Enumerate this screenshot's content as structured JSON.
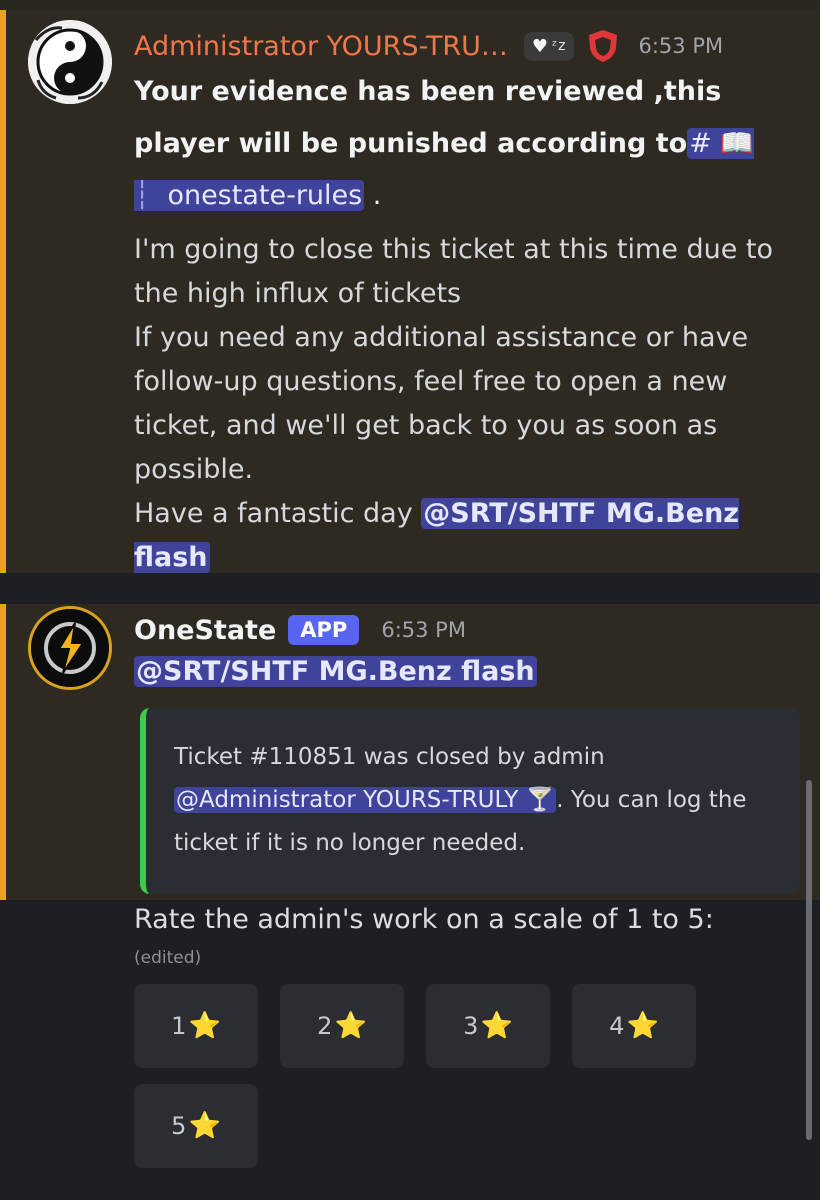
{
  "message1": {
    "author": "Administrator YOURS-TRU…",
    "status_icons": [
      "heart-icon",
      "sleep-zzz-icon"
    ],
    "status_zzz": "ᶻz",
    "badge_icon": "shield-icon",
    "badge_color": "#e0373a",
    "time": "6:53 PM",
    "bold_lead": "Your evidence has been reviewed ,this player will be punished according to",
    "channel_hash": "#",
    "channel_book": "📖",
    "channel_pipe": "┆",
    "channel_name": "onestate-rules",
    "bold_end": " .",
    "paragraph1": "I'm going to close this ticket at this time due to the high influx of tickets",
    "paragraph2": "If you need any additional assistance or have follow-up questions, feel free to open a new ticket, and we'll get back to you as soon as possible.",
    "paragraph3_lead": "Have a fantastic day ",
    "paragraph3_mention": "@SRT/SHTF MG.Benz flash"
  },
  "message2": {
    "author": "OneState",
    "app_tag": "APP",
    "time": "6:53 PM",
    "mention": "@SRT/SHTF MG.Benz flash",
    "embed": {
      "lead": "Ticket #110851 was closed by admin",
      "admin_mention": "@Administrator YOURS-TRULY 🍸",
      "tail": ". You can log the ticket if it is no longer needed.",
      "accent": "#3ecb48"
    },
    "rating_title": "Rate the admin's work on a scale of 1 to 5:",
    "edited": "(edited)",
    "buttons": [
      "1",
      "2",
      "3",
      "4",
      "5"
    ],
    "star": "⭐"
  },
  "colors": {
    "message_bg": "#2e2a22",
    "highlight_border": "#e6a31e",
    "mention_bg": "#3f4399",
    "app_tag_bg": "#5865f2",
    "admin_name": "#f07848"
  }
}
